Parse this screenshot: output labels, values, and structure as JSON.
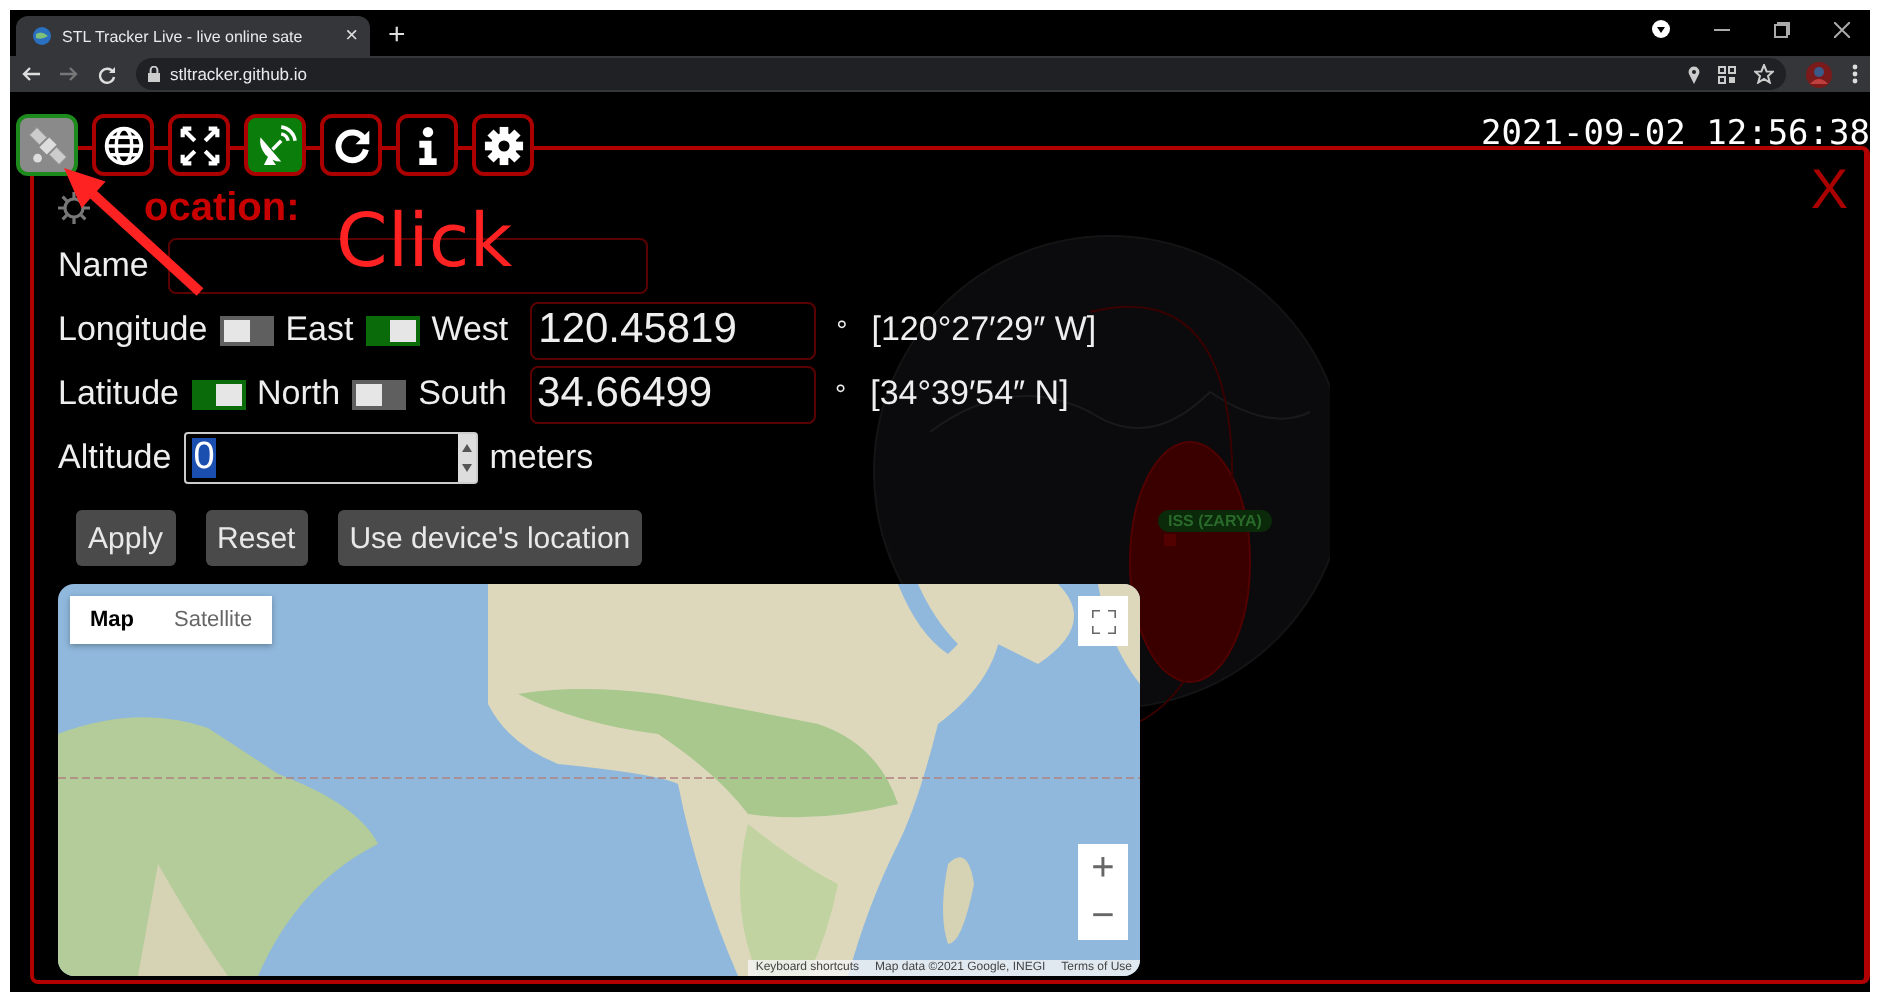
{
  "browser": {
    "tab_title": "STL Tracker Live - live online sate",
    "tab_close": "×",
    "new_tab": "+",
    "url": "stltracker.github.io"
  },
  "toolbar": [
    {
      "kind": "satellite",
      "selected": true,
      "on": false
    },
    {
      "kind": "globe",
      "selected": false,
      "on": false
    },
    {
      "kind": "fullscreen",
      "selected": false,
      "on": false
    },
    {
      "kind": "dish",
      "selected": false,
      "on": true
    },
    {
      "kind": "refresh",
      "selected": false,
      "on": false
    },
    {
      "kind": "info",
      "selected": false,
      "on": false
    },
    {
      "kind": "settings",
      "selected": false,
      "on": false
    }
  ],
  "clock": "2021-09-02 12:56:38",
  "close": "X",
  "globe": {
    "satellite_label": "ISS (ZARYA)"
  },
  "annotation": {
    "text": "Click"
  },
  "location": {
    "heading": "ocation:",
    "name_label": "Name",
    "coordinates": [
      {
        "label": "Longitude",
        "options": [
          {
            "label": "East",
            "on": false
          },
          {
            "label": "West",
            "on": true
          }
        ],
        "value": "120.45819",
        "unit": "°",
        "dms": "[120°27′29″ W]"
      },
      {
        "label": "Latitude",
        "options": [
          {
            "label": "North",
            "on": true
          },
          {
            "label": "South",
            "on": false
          }
        ],
        "value": "34.66499",
        "unit": "°",
        "dms": "[34°39′54″ N]"
      }
    ],
    "altitude": {
      "label": "Altitude",
      "value": "0",
      "unit": "meters"
    },
    "buttons": [
      "Apply",
      "Reset",
      "Use device's location"
    ]
  },
  "map": {
    "types": [
      {
        "label": "Map",
        "selected": true
      },
      {
        "label": "Satellite",
        "selected": false
      }
    ],
    "zoom_in": "+",
    "zoom_out": "−",
    "attribution": [
      "Keyboard shortcuts",
      "Map data ©2021 Google, INEGI",
      "Terms of Use"
    ]
  }
}
